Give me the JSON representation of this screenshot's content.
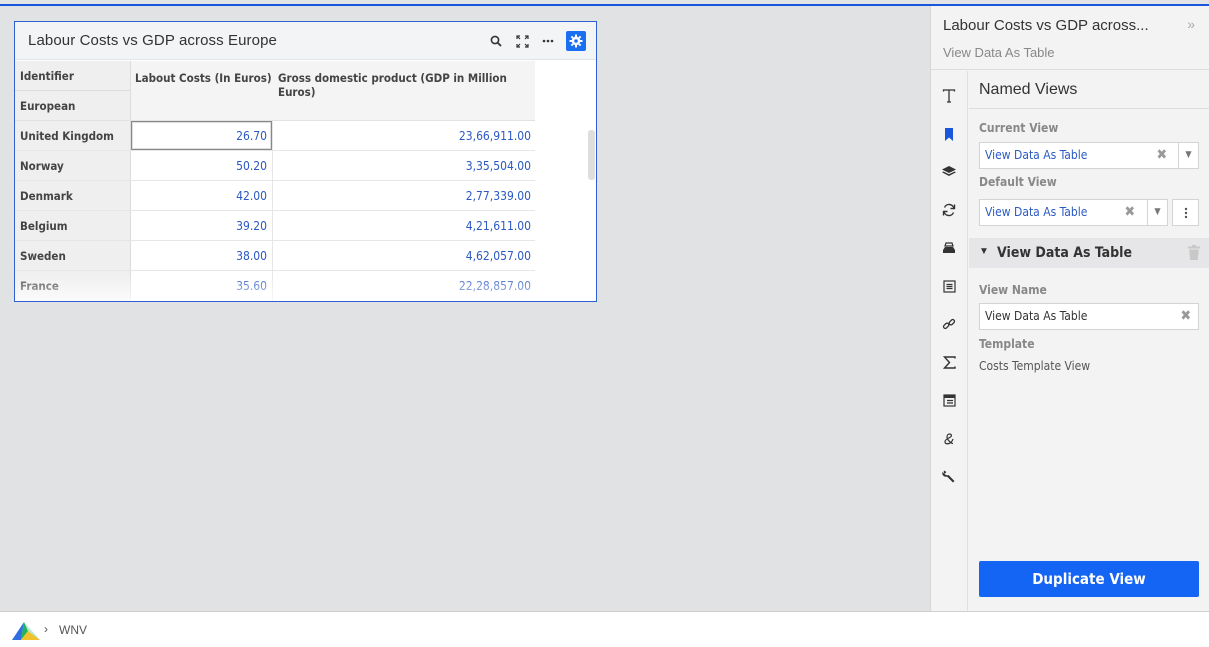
{
  "widget": {
    "title": "Labour Costs vs GDP across Europe",
    "tools": [
      "search-icon",
      "expand-icon",
      "more-icon",
      "settings-icon"
    ]
  },
  "table": {
    "row_header_labels": [
      "Identifier",
      "European Countries"
    ],
    "columns": [
      "Labout Costs (In Euros)",
      "Gross domestic product (GDP in Million Euros)"
    ],
    "rows": [
      {
        "country": "United Kingdom",
        "labour": "26.70",
        "gdp": "23,66,911.00"
      },
      {
        "country": "Norway",
        "labour": "50.20",
        "gdp": "3,35,504.00"
      },
      {
        "country": "Denmark",
        "labour": "42.00",
        "gdp": "2,77,339.00"
      },
      {
        "country": "Belgium",
        "labour": "39.20",
        "gdp": "4,21,611.00"
      },
      {
        "country": "Sweden",
        "labour": "38.00",
        "gdp": "4,62,057.00"
      },
      {
        "country": "France",
        "labour": "35.60",
        "gdp": "22,28,857.00"
      }
    ]
  },
  "panel": {
    "title": "Labour Costs vs GDP across...",
    "subtitle": "View Data As Table",
    "collapse_glyph": "»",
    "section_title": "Named Views",
    "current_view_label": "Current View",
    "current_view_value": "View Data As Table",
    "default_view_label": "Default View",
    "default_view_value": "View Data As Table",
    "group_title": "View Data As Table",
    "view_name_label": "View Name",
    "view_name_value": "View Data As Table",
    "template_label": "Template",
    "template_value": "Costs Template View",
    "duplicate_label": "Duplicate View"
  },
  "footer": {
    "breadcrumb": "WNV"
  },
  "colors": {
    "accent": "#1565f5",
    "value_text": "#2b59c3",
    "widget_border": "#2f5fd0"
  }
}
